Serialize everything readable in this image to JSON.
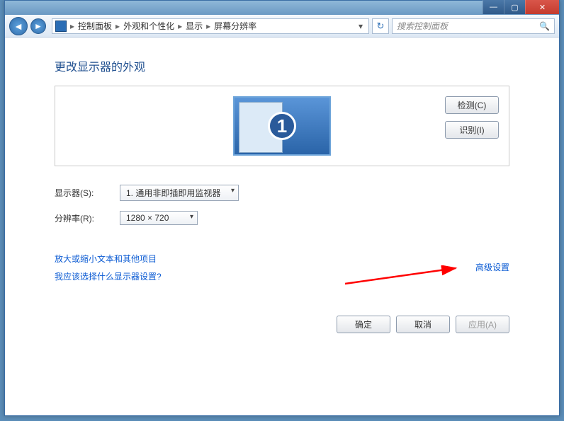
{
  "title_controls": {
    "min": "—",
    "max": "▢",
    "close": "✕"
  },
  "breadcrumb": {
    "items": [
      "控制面板",
      "外观和个性化",
      "显示",
      "屏幕分辨率"
    ],
    "sep": "▸"
  },
  "search": {
    "placeholder": "搜索控制面板"
  },
  "page_title": "更改显示器的外观",
  "monitor_number": "1",
  "side_buttons": {
    "detect": "检测(C)",
    "identify": "识别(I)"
  },
  "form": {
    "display_label": "显示器(S):",
    "display_value": "1. 通用非即插即用监视器",
    "resolution_label": "分辨率(R):",
    "resolution_value": "1280 × 720"
  },
  "advanced_link": "高级设置",
  "links": {
    "text_size": "放大或缩小文本和其他项目",
    "which_settings": "我应该选择什么显示器设置?"
  },
  "footer": {
    "ok": "确定",
    "cancel": "取消",
    "apply": "应用(A)"
  }
}
